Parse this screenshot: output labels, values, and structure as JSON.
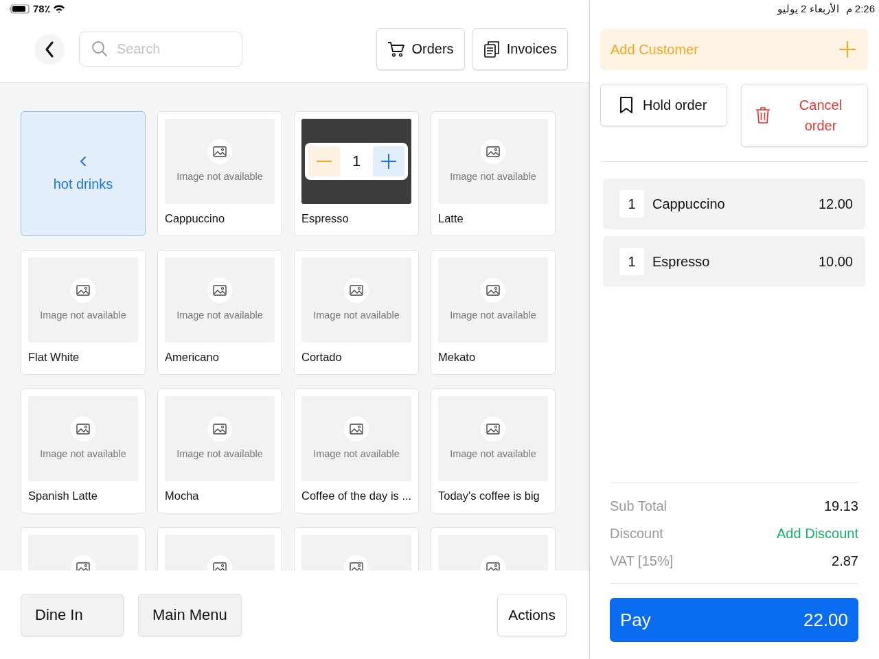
{
  "status_bar": {
    "battery": "78٪",
    "time": "2:26 م",
    "date": "الأربعاء 2 يوليو"
  },
  "header": {
    "search": {
      "placeholder": "Search"
    },
    "buttons": [
      {
        "kind": "orders",
        "label": "Orders"
      },
      {
        "kind": "invoices",
        "label": "Invoices"
      }
    ]
  },
  "items": [
    {
      "kind": "category",
      "name": "hot drinks"
    },
    {
      "kind": "product",
      "name": "Cappuccino",
      "image_text": "Image not available"
    },
    {
      "kind": "in-cart",
      "name": "Espresso",
      "quantity": "1"
    },
    {
      "kind": "product",
      "name": "Latte",
      "image_text": "Image not available"
    },
    {
      "kind": "product",
      "name": "Flat White",
      "image_text": "Image not available"
    },
    {
      "kind": "product",
      "name": "Americano",
      "image_text": "Image not available"
    },
    {
      "kind": "product",
      "name": "Cortado",
      "image_text": "Image not available"
    },
    {
      "kind": "product",
      "name": "Mekato",
      "image_text": "Image not available"
    },
    {
      "kind": "product",
      "name": "Spanish Latte",
      "image_text": "Image not available"
    },
    {
      "kind": "product",
      "name": "Mocha",
      "image_text": "Image not available"
    },
    {
      "kind": "product",
      "name": "Coffee of the day is ...",
      "image_text": "Image not available"
    },
    {
      "kind": "product",
      "name": "Today's coffee is big",
      "image_text": "Image not available"
    },
    {
      "kind": "partial"
    },
    {
      "kind": "partial"
    },
    {
      "kind": "partial"
    },
    {
      "kind": "partial"
    }
  ],
  "footer": {
    "left_buttons": [
      "Dine In",
      "Main Menu"
    ],
    "actions": "Actions"
  },
  "order": {
    "add_customer": "Add Customer",
    "hold": "Hold order",
    "cancel": "Cancel order",
    "lines": [
      {
        "qty": "1",
        "name": "Cappuccino",
        "price": "12.00"
      },
      {
        "qty": "1",
        "name": "Espresso",
        "price": "10.00"
      }
    ],
    "totals": [
      {
        "kind": "value",
        "label": "Sub Total",
        "value": "19.13"
      },
      {
        "kind": "link",
        "label": "Discount",
        "value": "Add Discount"
      },
      {
        "kind": "value",
        "label": "VAT [15%]",
        "value": "2.87"
      }
    ],
    "pay": {
      "label": "Pay",
      "amount": "22.00"
    }
  }
}
